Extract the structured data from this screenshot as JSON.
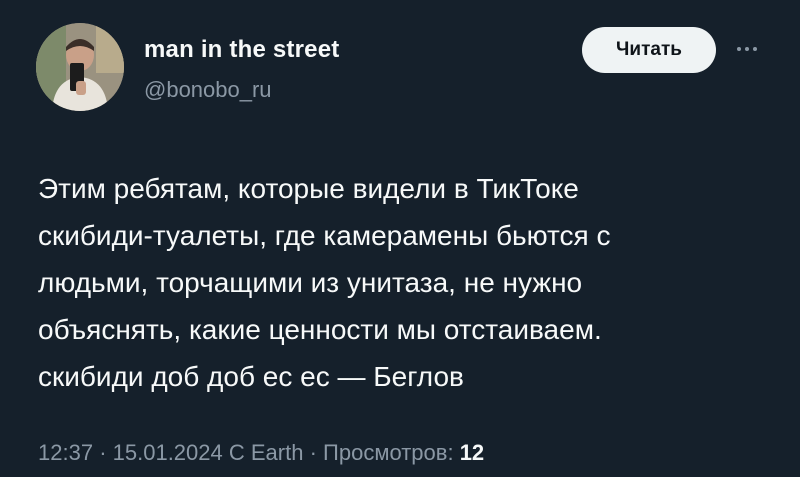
{
  "author": {
    "name": "man in the street",
    "handle": "@bonobo_ru"
  },
  "actions": {
    "follow_label": "Читать",
    "more_icon": "more-icon"
  },
  "tweet": {
    "lines": [
      "Этим ребятам, которые видели в ТикТоке",
      "скибиди-туалеты, где камерамены бьются с",
      "людьми, торчащими из унитаза, не нужно",
      "объяснять, какие ценности мы отстаиваем.",
      "скибиди доб доб ес ес — Беглов"
    ]
  },
  "meta": {
    "time": "12:37",
    "separator": "·",
    "date": "15.01.2024",
    "source": "C Earth",
    "views_label": "Просмотров:",
    "views_count": "12"
  },
  "colors": {
    "background": "#15202b",
    "text_primary": "#f7f9f9",
    "text_secondary": "#8b98a5",
    "button_bg": "#eff3f4"
  }
}
